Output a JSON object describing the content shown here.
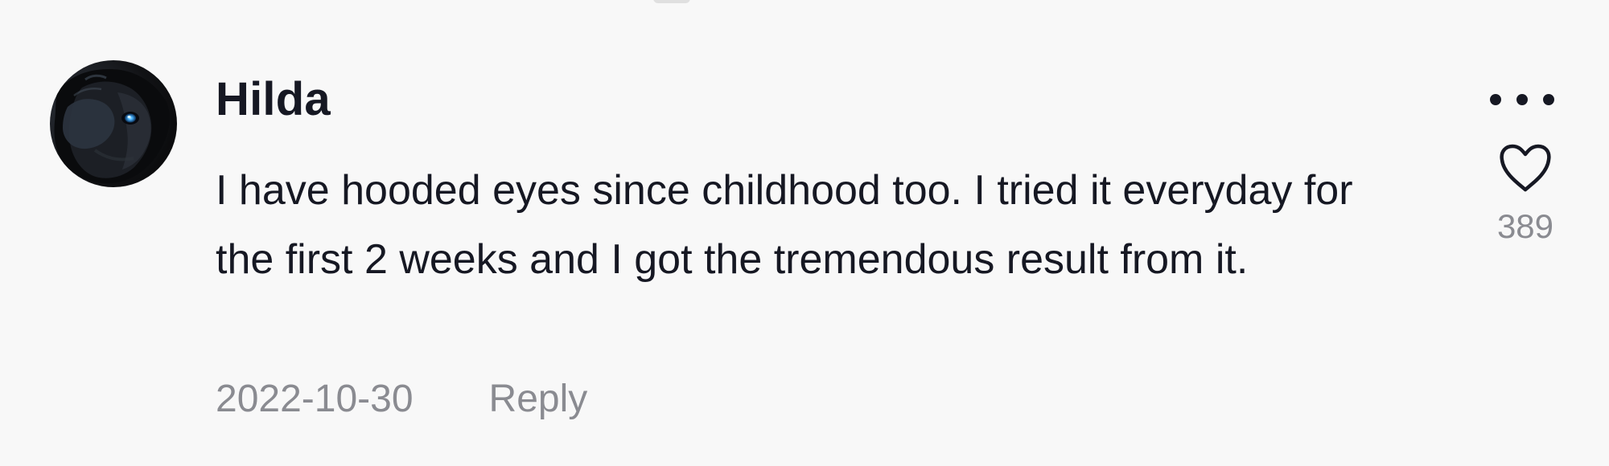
{
  "comment": {
    "author": "Hilda",
    "text": "I have hooded eyes since childhood too. I tried it everyday for the first 2 weeks and I got the tremendous result from it.",
    "date": "2022-10-30",
    "reply_label": "Reply",
    "like_count": "389",
    "icons": {
      "more": "more-options-icon",
      "like": "heart-icon"
    },
    "colors": {
      "background": "#f8f8f8",
      "primary_text": "#161823",
      "secondary_text": "#8a8b91"
    }
  }
}
